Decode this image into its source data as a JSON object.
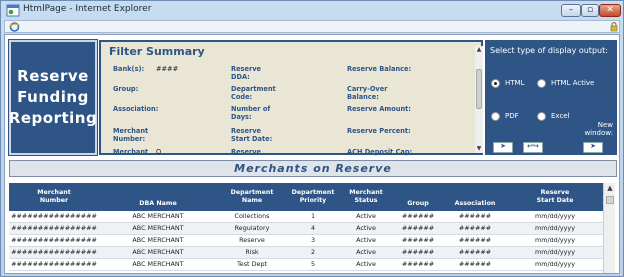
{
  "window": {
    "title": "HtmlPage - Internet Explorer",
    "min_symbol": "–",
    "max_symbol": "▫",
    "close_symbol": "✕"
  },
  "brand": {
    "title": "Reserve\nFunding\nReporting"
  },
  "filter": {
    "title": "Filter Summary",
    "fields": [
      {
        "label": "Bank(s):",
        "value": "####"
      },
      {
        "label": "Group:",
        "value": ""
      },
      {
        "label": "Association:",
        "value": ""
      },
      {
        "label": "Merchant Number:",
        "value": ""
      },
      {
        "label": "Merchant",
        "value": "O"
      },
      {
        "label": "Reserve DDA:",
        "value": ""
      },
      {
        "label": "Department Code:",
        "value": ""
      },
      {
        "label": "Number of Days:",
        "value": ""
      },
      {
        "label": "Reserve Start Date:",
        "value": ""
      },
      {
        "label": "Reserve",
        "value": ""
      },
      {
        "label": "Reserve Balance:",
        "value": ""
      },
      {
        "label": "Carry-Over Balance:",
        "value": ""
      },
      {
        "label": "Reserve Amount:",
        "value": ""
      },
      {
        "label": "Reserve Percent:",
        "value": ""
      },
      {
        "label": "ACH Deposit Cap:",
        "value": ""
      }
    ]
  },
  "display": {
    "title": "Select type of display output:",
    "options": [
      {
        "label": "HTML",
        "selected": true
      },
      {
        "label": "HTML Active",
        "selected": false
      },
      {
        "label": "PDF",
        "selected": false
      },
      {
        "label": "Excel",
        "selected": false
      }
    ],
    "new_window_label": "New window:",
    "buttons": [
      {
        "symbol": "➤",
        "icon": "run-icon"
      },
      {
        "symbol": "↩↪",
        "icon": "refresh-icon"
      },
      {
        "symbol": "➤",
        "icon": "new-window-icon"
      }
    ]
  },
  "banner": {
    "title": "Merchants on Reserve"
  },
  "table": {
    "columns": [
      "Merchant\nNumber",
      "DBA Name",
      "Department\nName",
      "Department\nPriority",
      "Merchant\nStatus",
      "Group",
      "Association",
      "Reserve\nStart Date"
    ],
    "rows": [
      [
        "################",
        "ABC MERCHANT",
        "Collections",
        "1",
        "Active",
        "######",
        "######",
        "mm/dd/yyyy"
      ],
      [
        "################",
        "ABC MERCHANT",
        "Regulatory",
        "4",
        "Active",
        "######",
        "######",
        "mm/dd/yyyy"
      ],
      [
        "################",
        "ABC MERCHANT",
        "Reserve",
        "3",
        "Active",
        "######",
        "######",
        "mm/dd/yyyy"
      ],
      [
        "################",
        "ABC MERCHANT",
        "Risk",
        "2",
        "Active",
        "######",
        "######",
        "mm/dd/yyyy"
      ],
      [
        "################",
        "ABC MERCHANT",
        "Test Dept",
        "5",
        "Active",
        "######",
        "######",
        "mm/dd/yyyy"
      ]
    ]
  },
  "colors": {
    "brand_blue": "#2e5586",
    "filter_bg": "#e9e6d6",
    "banner_bg": "#dfe3ea"
  }
}
